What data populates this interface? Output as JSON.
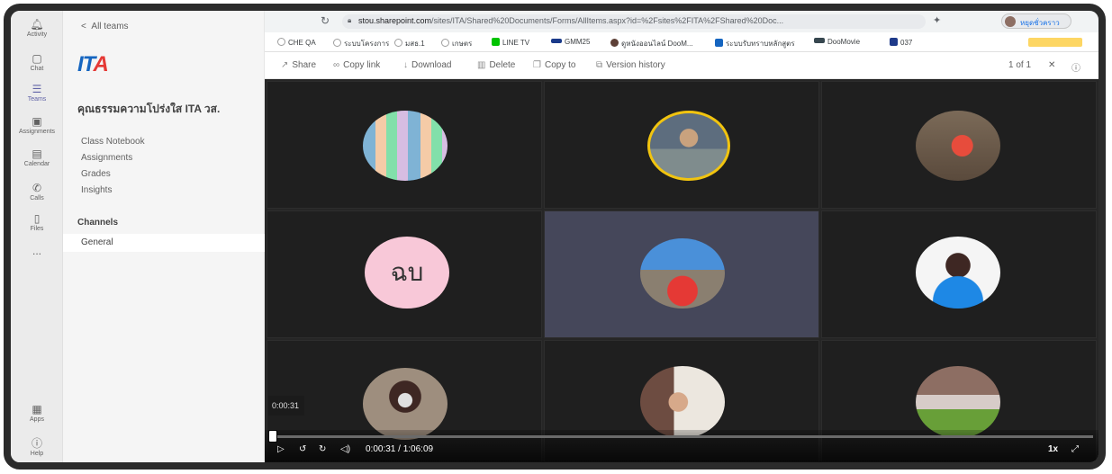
{
  "rail": [
    {
      "label": "Activity",
      "icon": "bell-icon",
      "glyph": "🔔"
    },
    {
      "label": "Chat",
      "icon": "chat-icon",
      "glyph": "💬"
    },
    {
      "label": "Teams",
      "icon": "teams-icon",
      "glyph": "👥"
    },
    {
      "label": "Assignments",
      "icon": "assignments-icon",
      "glyph": "🎒"
    },
    {
      "label": "Calendar",
      "icon": "calendar-icon",
      "glyph": "📅"
    },
    {
      "label": "Calls",
      "icon": "phone-icon",
      "glyph": "📞"
    },
    {
      "label": "Files",
      "icon": "file-icon",
      "glyph": "📄"
    },
    {
      "label": "...",
      "icon": "more-icon",
      "glyph": ""
    },
    {
      "label": "Apps",
      "icon": "apps-icon",
      "glyph": "▦"
    },
    {
      "label": "Help",
      "icon": "help-icon",
      "glyph": "?"
    }
  ],
  "panel": {
    "back_label": "All teams",
    "logo_text": "ITA",
    "team_name": "คุณธรรมความโปร่งใส ITA วส.",
    "tabs": [
      "Class Notebook",
      "Assignments",
      "Grades",
      "Insights"
    ],
    "channels_heading": "Channels",
    "channel": "General"
  },
  "browser": {
    "url_host": "stou.sharepoint.com",
    "url_path": "/sites/ITA/Shared%20Documents/Forms/AllItems.aspx?id=%2Fsites%2FITA%2FShared%20Doc...",
    "profile_label": "หยุดชั่วคราว",
    "bookmarks": [
      {
        "label": "CHE QA",
        "color": "#9e9e9e"
      },
      {
        "label": "ระบบโครงการ",
        "color": "#9e9e9e"
      },
      {
        "label": "มสธ.1",
        "color": "#9e9e9e"
      },
      {
        "label": "เกษตร",
        "color": "#9e9e9e"
      },
      {
        "label": "LINE TV",
        "color": "#00c300"
      },
      {
        "label": "GMM25",
        "color": "#1a3a8a"
      },
      {
        "label": "ดูหนังออนไลน์ DooM...",
        "color": "#5d4037"
      },
      {
        "label": "ระบบรับทราบหลักสูตร",
        "color": "#1565c0"
      },
      {
        "label": "DooMovie",
        "color": "#37474f"
      },
      {
        "label": "037",
        "color": "#1e3a8a"
      }
    ]
  },
  "viewer": {
    "share": "Share",
    "copy_link": "Copy link",
    "download": "Download",
    "delete": "Delete",
    "copy_to": "Copy to",
    "version_history": "Version history",
    "page_count": "1 of 1"
  },
  "player": {
    "time_chip": "0:00:31",
    "current_time": "0:00:31",
    "separator": "/",
    "duration": "1:06:09",
    "speed": "1x",
    "progress_fraction": 0.008
  },
  "tiles": [
    {
      "name": "",
      "avatar": "apps-grid"
    },
    {
      "name": "",
      "avatar": "man-glasses"
    },
    {
      "name": "",
      "avatar": "woman-red"
    },
    {
      "name": "",
      "avatar": "initials",
      "initials": "ฉบ"
    },
    {
      "name": "",
      "avatar": "woman-mountain"
    },
    {
      "name": "",
      "avatar": "woman-blue"
    },
    {
      "name": "",
      "avatar": "woman-mask"
    },
    {
      "name": "",
      "avatar": "man-office"
    },
    {
      "name": "",
      "avatar": "food"
    }
  ]
}
